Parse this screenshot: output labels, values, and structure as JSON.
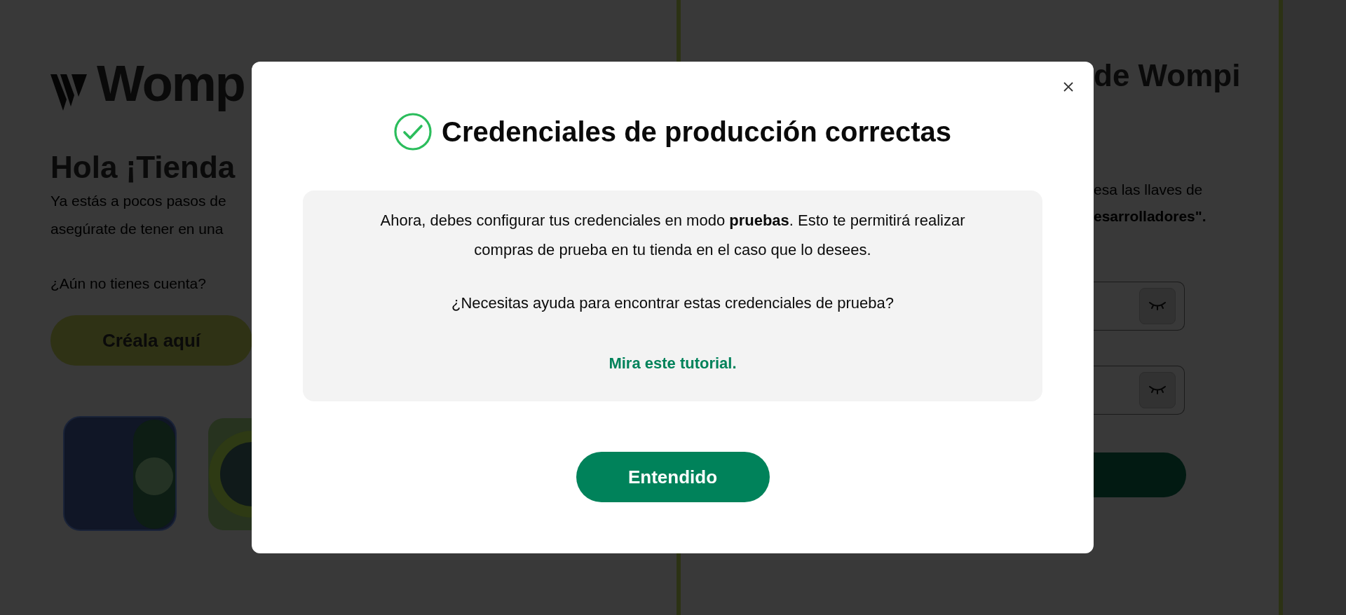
{
  "background": {
    "logo": {
      "text": "Womp"
    },
    "heading": "Hola ¡Tienda",
    "paragraph_lines": [
      "Ya estás a pocos pasos de",
      "asegúrate de tener en una"
    ],
    "signup_prompt": "¿Aún no tienes cuenta?",
    "signup_button": "Créala aquí",
    "right_heading": "de Wompi",
    "instruction_lines": [
      {
        "text": "esa las llaves de",
        "bold": false
      },
      {
        "text": "esarrolladores\".",
        "bold": true
      }
    ],
    "fields": [
      {
        "masked": true
      },
      {
        "masked": true
      }
    ]
  },
  "modal": {
    "title": "Credenciales de producción correctas",
    "message": "Ahora, debes configurar tus credenciales en modo **pruebas**. Esto te permitirá realizar compras de prueba en tu tienda en el caso que lo desees.",
    "question": "¿Necesitas ayuda para encontrar estas credenciales de prueba?",
    "link": "Mira este tutorial.",
    "button": "Entendido"
  }
}
